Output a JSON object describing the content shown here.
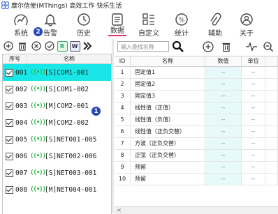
{
  "app": {
    "title": "摩尔信使(MThings) 高效工作 快乐生活"
  },
  "nav": {
    "items": [
      {
        "label": "系统",
        "icon": "chart-icon"
      },
      {
        "label": "告警",
        "icon": "bell-icon"
      },
      {
        "label": "历史",
        "icon": "history-icon"
      },
      {
        "label": "数据",
        "icon": "document-icon"
      },
      {
        "label": "自定义",
        "icon": "layout-icon"
      },
      {
        "label": "统计",
        "icon": "percent-icon"
      },
      {
        "label": "辅助",
        "icon": "paperclip-icon"
      },
      {
        "label": "关于",
        "icon": "user-icon"
      }
    ],
    "active": "数据"
  },
  "left_toolbar": {
    "btn_r": "R",
    "btn_w": "W"
  },
  "badges": {
    "one": "1",
    "two": "2"
  },
  "device_list": {
    "headers": {
      "index": "序号",
      "name": "名称"
    },
    "rows": [
      {
        "num": "001",
        "name": "[S]COM1-001",
        "selected": true
      },
      {
        "num": "002",
        "name": "[S]COM1-002",
        "selected": false
      },
      {
        "num": "003",
        "name": "[M]COM2-001",
        "selected": false
      },
      {
        "num": "004",
        "name": "[M]COM2-002",
        "selected": false
      },
      {
        "num": "005",
        "name": "[S]NET001-005",
        "selected": false
      },
      {
        "num": "006",
        "name": "[S]NET002-006",
        "selected": false
      },
      {
        "num": "007",
        "name": "[S]NET003-001",
        "selected": false
      },
      {
        "num": "008",
        "name": "[M]NET004-001",
        "selected": false
      }
    ],
    "signal_glyph": "((•))"
  },
  "search": {
    "placeholder": "输入查找名称"
  },
  "data_table": {
    "headers": {
      "id": "ID",
      "name": "名称",
      "value": "数值",
      "unit": "单位"
    },
    "rows": [
      {
        "id": "1",
        "name": "固定值1",
        "value": "--",
        "unit": "--"
      },
      {
        "id": "2",
        "name": "固定值2",
        "value": "--",
        "unit": "--"
      },
      {
        "id": "3",
        "name": "固定值3",
        "value": "--",
        "unit": "--"
      },
      {
        "id": "4",
        "name": "线性值（正值）",
        "value": "--",
        "unit": "--"
      },
      {
        "id": "5",
        "name": "线性值（负值）",
        "value": "--",
        "unit": "--"
      },
      {
        "id": "6",
        "name": "线性值（正负交替）",
        "value": "--",
        "unit": "--"
      },
      {
        "id": "7",
        "name": "方波（正负交替）",
        "value": "--",
        "unit": "--"
      },
      {
        "id": "8",
        "name": "正弦（正负交替）",
        "value": "--",
        "unit": "--"
      },
      {
        "id": "9",
        "name": "预留",
        "value": "--",
        "unit": "--"
      },
      {
        "id": "10",
        "name": "预留",
        "value": "--",
        "unit": "--"
      }
    ]
  },
  "scroll": {
    "left_arrow": "<"
  },
  "colors": {
    "selected_row": "#19e6e6",
    "active_tab_underline": "#e0336a",
    "signal": "#2fb84a",
    "badge": "#2446b8"
  }
}
